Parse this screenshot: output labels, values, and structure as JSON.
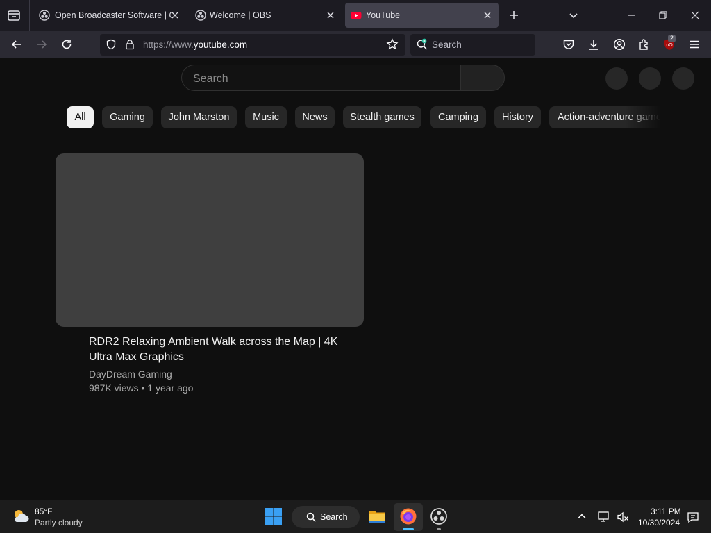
{
  "browser": {
    "tabs": [
      {
        "title": "Open Broadcaster Software | OBS",
        "favicon": "obs-icon",
        "active": false
      },
      {
        "title": "Welcome | OBS",
        "favicon": "obs-icon",
        "active": false
      },
      {
        "title": "YouTube",
        "favicon": "youtube-icon",
        "active": true
      }
    ],
    "url_scheme": "https://www.",
    "url_host": "youtube.com",
    "search_label": "Search",
    "extension_badge": "2"
  },
  "youtube": {
    "search_placeholder": "Search",
    "chips": [
      "All",
      "Gaming",
      "John Marston",
      "Music",
      "News",
      "Stealth games",
      "Camping",
      "History",
      "Action-adventure games"
    ],
    "selected_chip": "All",
    "video": {
      "title": "RDR2 Relaxing Ambient Walk across the Map | 4K Ultra Max Graphics",
      "channel": "DayDream Gaming",
      "meta": "987K views • 1 year ago"
    }
  },
  "taskbar": {
    "weather_temp": "85°F",
    "weather_condition": "Partly cloudy",
    "search_label": "Search",
    "time": "3:11 PM",
    "date": "10/30/2024"
  },
  "colors": {
    "accent": "#f1f1f1",
    "youtube_red": "#ff0033",
    "indicator": "#4cc2ff"
  }
}
